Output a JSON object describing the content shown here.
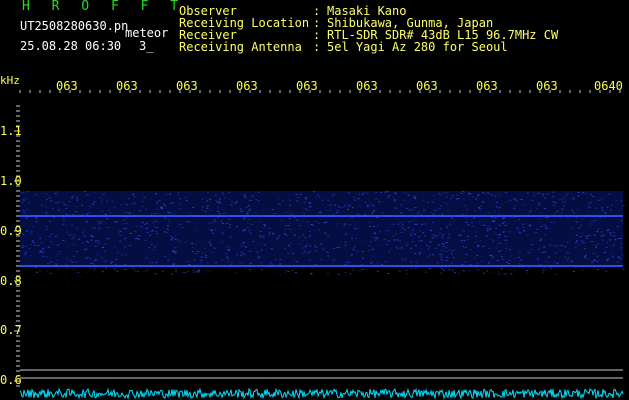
{
  "header": {
    "title": "H R O F F T",
    "filename": "UT2508280630.pn",
    "meteor_tag": "meteor",
    "datetime": "25.08.28 06:30",
    "count": "3_"
  },
  "meta": {
    "observer_label": "Observer",
    "observer_value": "Masaki Kano",
    "location_label": "Receiving Location",
    "location_value": "Shibukawa, Gunma, Japan",
    "receiver_label": "Receiver",
    "receiver_value": "RTL-SDR SDR# 43dB L15 96.7MHz CW",
    "antenna_label": "Receiving Antenna",
    "antenna_value": "5el Yagi Az 280 for Seoul",
    "colon": ":"
  },
  "axis": {
    "unit": "kHz",
    "x_ticks": [
      "063",
      "063",
      "063",
      "063",
      "063",
      "063",
      "063",
      "063",
      "063",
      "0640"
    ],
    "y_ticks": [
      "1.1",
      "1.0",
      "0.9",
      "0.8",
      "0.7",
      "0.6"
    ]
  },
  "colors": {
    "background": "#000000",
    "grid": "#c8c8c8",
    "signal": "#3355ff",
    "noise": "#0a1a7a",
    "power_trace": "#00e0ff",
    "title": "#22dd22",
    "header_text": "#ffffff",
    "meta_text": "#ffff66",
    "tick_text": "#ffff44"
  },
  "chart_data": {
    "type": "heatmap",
    "y_unit": "kHz",
    "ylim": [
      0.6,
      1.15
    ],
    "x_tick_labels": [
      "063",
      "063",
      "063",
      "063",
      "063",
      "063",
      "063",
      "063",
      "063",
      "0640"
    ],
    "y_tick_labels": [
      "1.1",
      "1.0",
      "0.9",
      "0.8",
      "0.7",
      "0.6"
    ],
    "y_ticks": [
      1.1,
      1.0,
      0.9,
      0.8,
      0.7,
      0.6
    ],
    "noise_band": [
      0.83,
      0.98
    ],
    "carrier_lines_khz": [
      0.93,
      0.83
    ],
    "grid": true
  }
}
